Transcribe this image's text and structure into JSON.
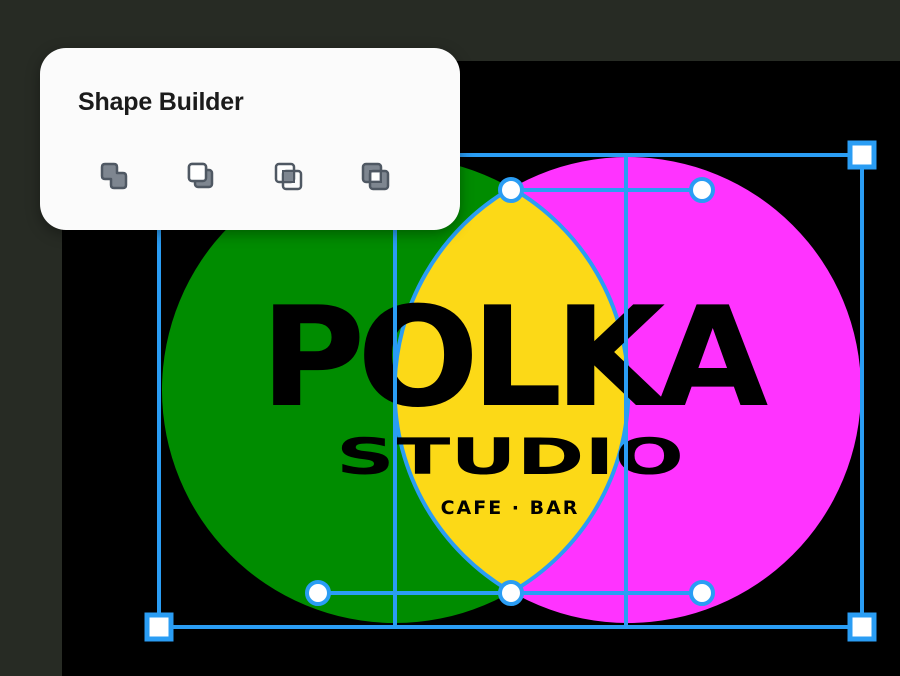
{
  "panel": {
    "title": "Shape Builder",
    "tools": [
      {
        "icon": "union-icon",
        "name": "union"
      },
      {
        "icon": "subtract-icon",
        "name": "subtract"
      },
      {
        "icon": "intersect-icon",
        "name": "intersect"
      },
      {
        "icon": "exclude-icon",
        "name": "exclude"
      }
    ]
  },
  "artwork": {
    "wordmark": "POLKA",
    "subtitle": "STUDIO",
    "tagline": "CAFE · BAR",
    "colors": {
      "left_circle": "#008c00",
      "right_circle": "#ff33ff",
      "overlap": "#fcd917",
      "selection": "#2a9df4",
      "text": "#000000"
    }
  },
  "colors": {
    "app_background": "#272b24",
    "canvas": "#000000",
    "panel": "#fbfbfb",
    "icon_fill": "#7e8690",
    "icon_stroke": "#4f5863"
  }
}
